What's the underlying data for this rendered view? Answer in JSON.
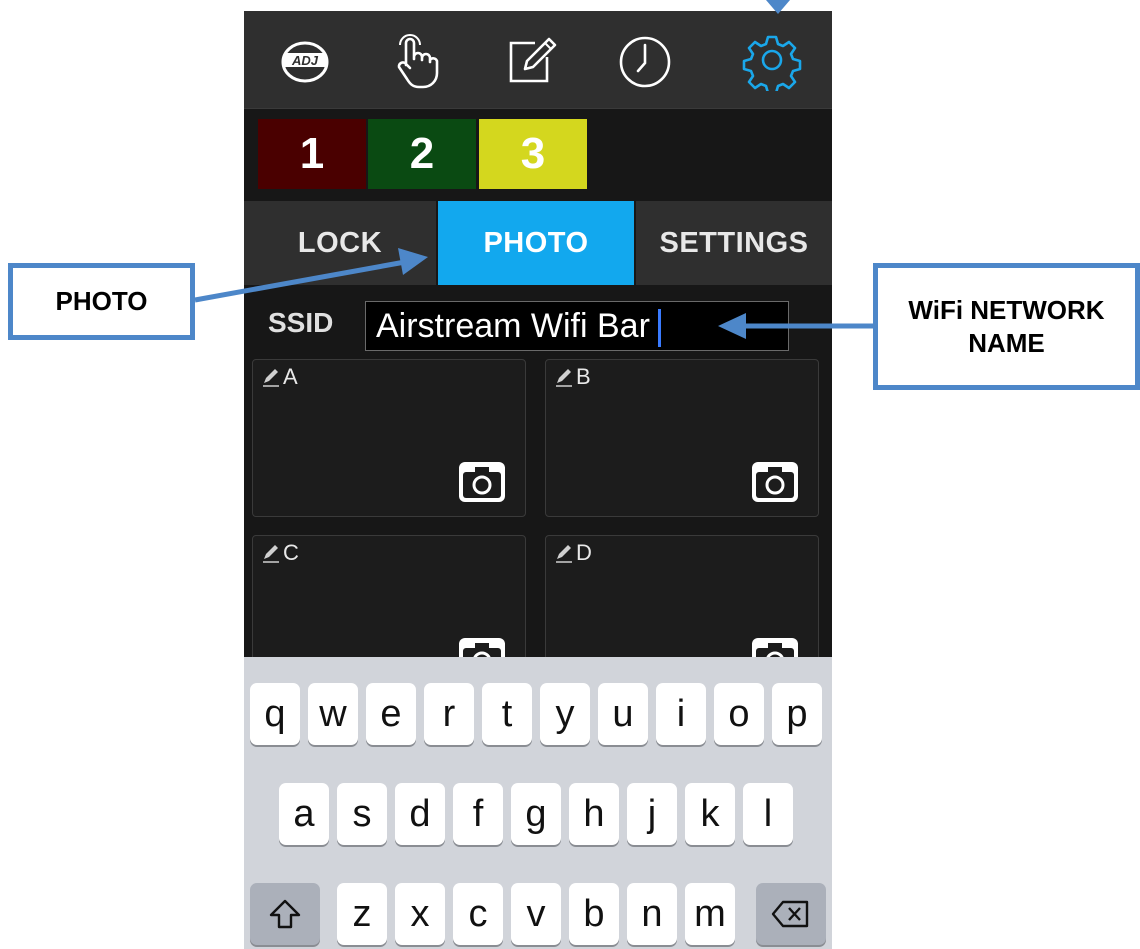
{
  "toolbar": {
    "logo_text": "ADJ",
    "icons": [
      "adj-logo-icon",
      "touch-hand-icon",
      "edit-pencil-icon",
      "clock-icon",
      "gear-icon"
    ],
    "active_color": "#1aa7ea"
  },
  "scenes": [
    {
      "label": "1",
      "color": "#4a0000"
    },
    {
      "label": "2",
      "color": "#0a4a12"
    },
    {
      "label": "3",
      "color": "#d4d71e"
    }
  ],
  "tabs": [
    {
      "label": "LOCK",
      "active": false
    },
    {
      "label": "PHOTO",
      "active": true
    },
    {
      "label": "SETTINGS",
      "active": false
    }
  ],
  "ssid": {
    "label": "SSID",
    "value": "Airstream Wifi Bar"
  },
  "photo_cells": [
    {
      "label": "A"
    },
    {
      "label": "B"
    },
    {
      "label": "C"
    },
    {
      "label": "D"
    }
  ],
  "keyboard": {
    "row1": [
      "q",
      "w",
      "e",
      "r",
      "t",
      "y",
      "u",
      "i",
      "o",
      "p"
    ],
    "row2": [
      "a",
      "s",
      "d",
      "f",
      "g",
      "h",
      "j",
      "k",
      "l"
    ],
    "row3": [
      "z",
      "x",
      "c",
      "v",
      "b",
      "n",
      "m"
    ],
    "shift_icon": "shift-icon",
    "backspace_icon": "backspace-icon"
  },
  "annotations": {
    "photo_callout": "PHOTO",
    "wifi_callout_line1": "WiFi NETWORK",
    "wifi_callout_line2": "NAME",
    "color": "#4d87c9"
  }
}
